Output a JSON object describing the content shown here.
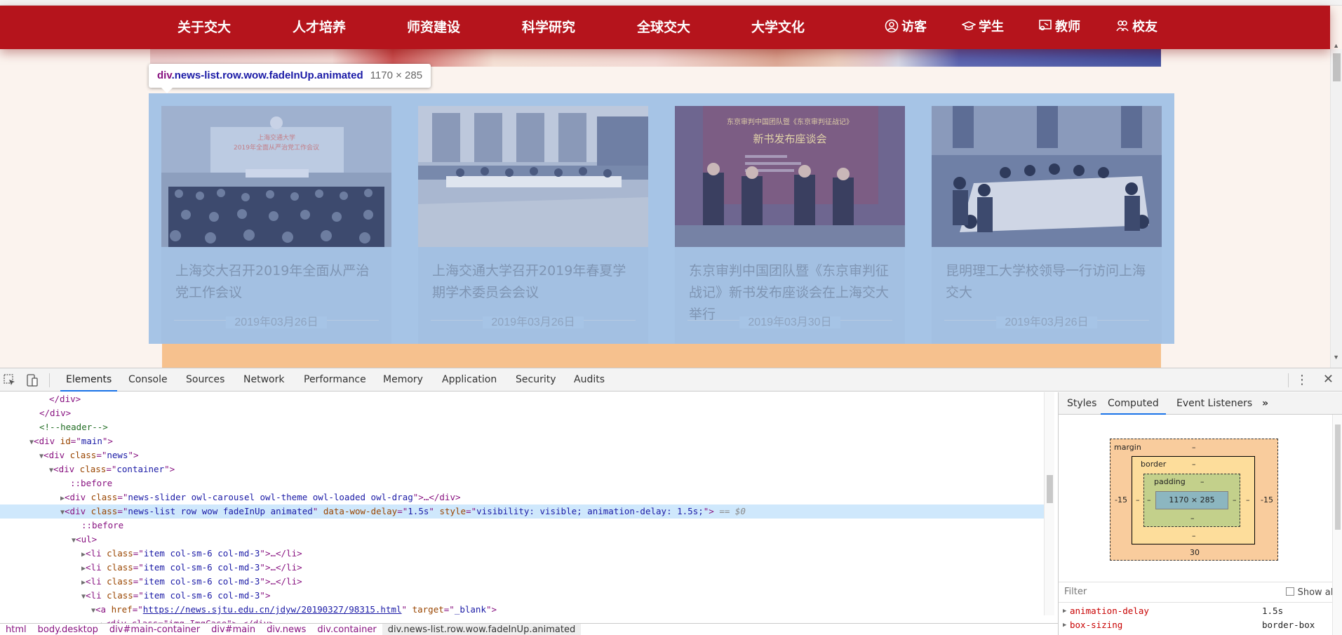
{
  "nav": {
    "items": [
      "关于交大",
      "人才培养",
      "师资建设",
      "科学研究",
      "全球交大",
      "大学文化"
    ],
    "roles": [
      {
        "icon": "user-circle-icon",
        "label": "访客"
      },
      {
        "icon": "graduation-cap-icon",
        "label": "学生"
      },
      {
        "icon": "teacher-icon",
        "label": "教师"
      },
      {
        "icon": "alumni-icon",
        "label": "校友"
      }
    ]
  },
  "tooltip": {
    "tag": "div",
    "classes": ".news-list.row.wow.fadeInUp.animated",
    "size": "1170 × 285"
  },
  "news": [
    {
      "title": "上海交大召开2019年全面从严治党工作会议",
      "date": "2019年03月26日",
      "img_caption_1": "上海交通大学",
      "img_caption_2": "2019年全面从严治党工作会议"
    },
    {
      "title": "上海交通大学召开2019年春夏学期学术委员会会议",
      "date": "2019年03月26日"
    },
    {
      "title": "东京审判中国团队暨《东京审判征战记》新书发布座谈会在上海交大举行",
      "date": "2019年03月30日",
      "img_caption_1": "东京审判中国团队暨《东京审判征战记》",
      "img_caption_2": "新书发布座谈会"
    },
    {
      "title": "昆明理工大学校领导一行访问上海交大",
      "date": "2019年03月26日"
    }
  ],
  "devtools": {
    "tabs": [
      "Elements",
      "Console",
      "Sources",
      "Network",
      "Performance",
      "Memory",
      "Application",
      "Security",
      "Audits"
    ],
    "active_tab": "Elements",
    "dom": {
      "l1": "</div>",
      "l2": "</div>",
      "l3": "<!--header-->",
      "l4_tag": "div",
      "l4_attr": "id",
      "l4_val": "main",
      "l5_tag": "div",
      "l5_attr": "class",
      "l5_val": "news",
      "l6_tag": "div",
      "l6_attr": "class",
      "l6_val": "container",
      "l7": "::before",
      "l8_val": "news-slider owl-carousel owl-theme owl-loaded owl-drag",
      "l9_val": "news-list row wow fadeInUp animated",
      "l9_attr2": "data-wow-delay",
      "l9_val2": "1.5s",
      "l9_attr3": "style",
      "l9_val3": "visibility: visible; animation-delay: 1.5s;",
      "l9_eq": "== $0",
      "l10": "::before",
      "l11_tag": "ul",
      "li_val": "item col-sm-6 col-md-3",
      "a_href": "https://news.sjtu.edu.cn/jdyw/20190327/98315.html",
      "a_target": "_blank",
      "last_partial": "<div class=\"img ImgCase\">…</div>"
    },
    "breadcrumbs": [
      "html",
      "body.desktop",
      "div#main-container",
      "div#main",
      "div.news",
      "div.container",
      "div.news-list.row.wow.fadeInUp.animated"
    ],
    "side_tabs": [
      "Styles",
      "Computed",
      "Event Listeners"
    ],
    "side_active": "Computed",
    "box_model": {
      "margin_label": "margin",
      "border_label": "border",
      "padding_label": "padding",
      "content": "1170 × 285",
      "margin_top": "–",
      "margin_left": "-15",
      "margin_right": "-15",
      "margin_bottom": "30",
      "border_top": "–",
      "border_left": "–",
      "border_right": "–",
      "border_bottom": "–",
      "padding_top": "–",
      "padding_left": "–",
      "padding_right": "–",
      "padding_bottom": "–"
    },
    "filter_placeholder": "Filter",
    "show_all": "Show all",
    "props": [
      {
        "name": "animation-delay",
        "value": "1.5s"
      },
      {
        "name": "box-sizing",
        "value": "border-box"
      }
    ]
  }
}
